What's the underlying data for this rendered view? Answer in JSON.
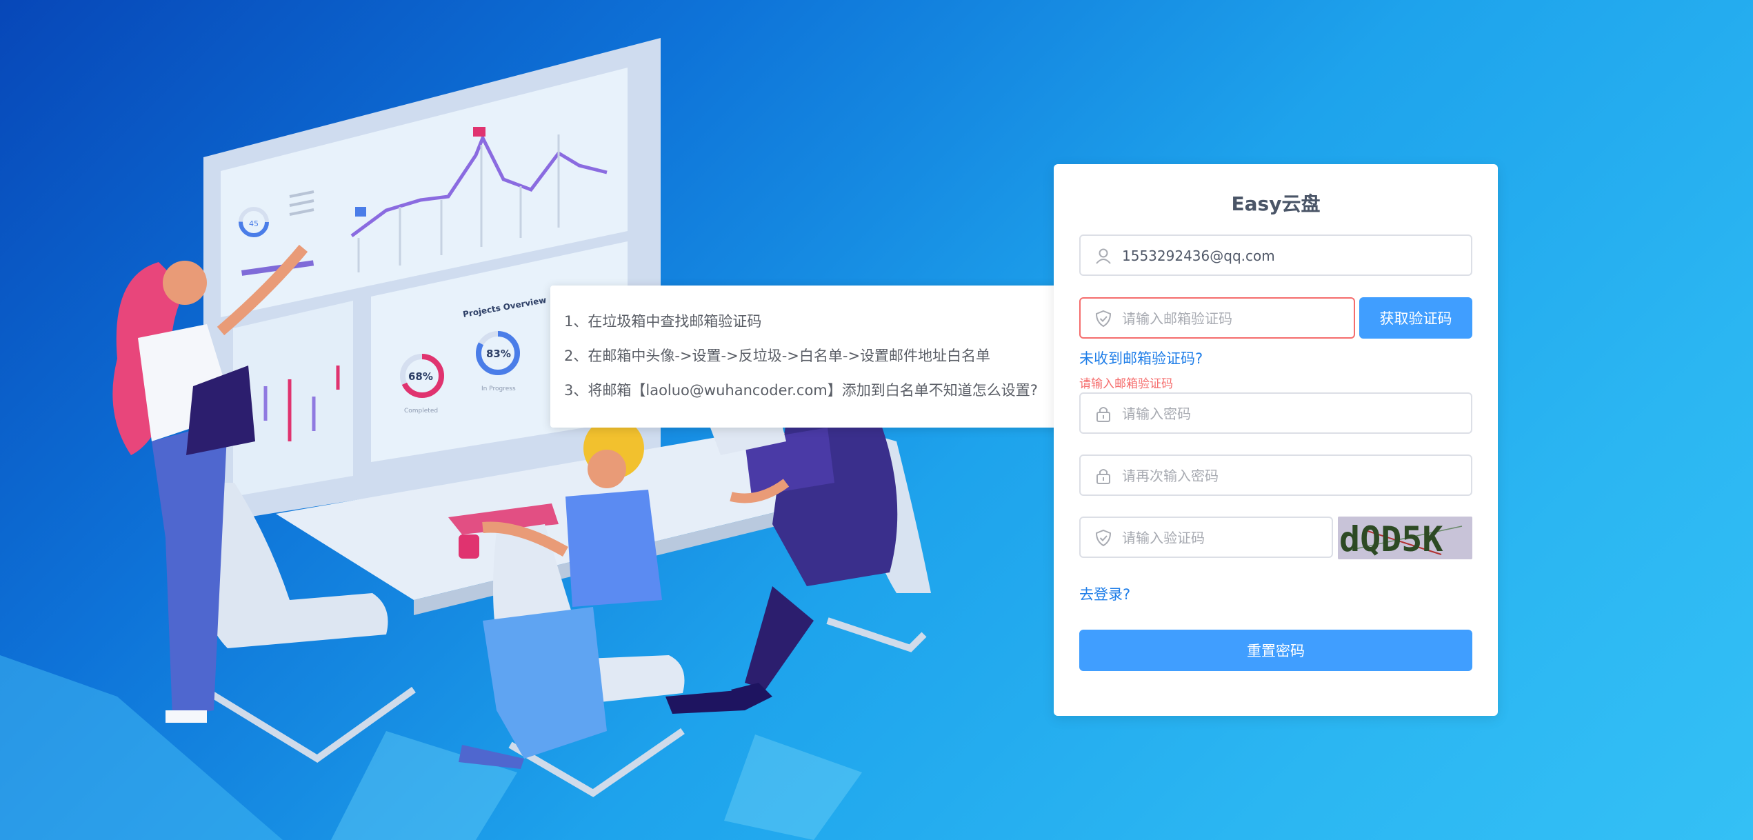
{
  "app": {
    "title": "Easy云盘"
  },
  "form": {
    "email_value": "1553292436@qq.com",
    "email_code_placeholder": "请输入邮箱验证码",
    "get_code_label": "获取验证码",
    "no_code_link": "未收到邮箱验证码?",
    "email_code_error": "请输入邮箱验证码",
    "password_placeholder": "请输入密码",
    "password_confirm_placeholder": "请再次输入密码",
    "captcha_placeholder": "请输入验证码",
    "captcha_text": "dQD5K",
    "login_link": "去登录?",
    "reset_label": "重置密码"
  },
  "tooltip": {
    "lines": [
      "1、在垃圾箱中查找邮箱验证码",
      "2、在邮箱中头像->设置->反垃圾->白名单->设置邮件地址白名单",
      "3、将邮箱【laoluo@wuhancoder.com】添加到白名单不知道怎么设置?"
    ]
  },
  "illustration": {
    "left_gauge": "45",
    "donut_1": "68%",
    "donut_2": "83%",
    "panel_title": "Projects Overview",
    "donut_1_caption": "Completed",
    "donut_2_caption": "In Progress"
  },
  "colors": {
    "primary": "#409eff",
    "error": "#f56c6c",
    "link": "#1f7ee8"
  }
}
